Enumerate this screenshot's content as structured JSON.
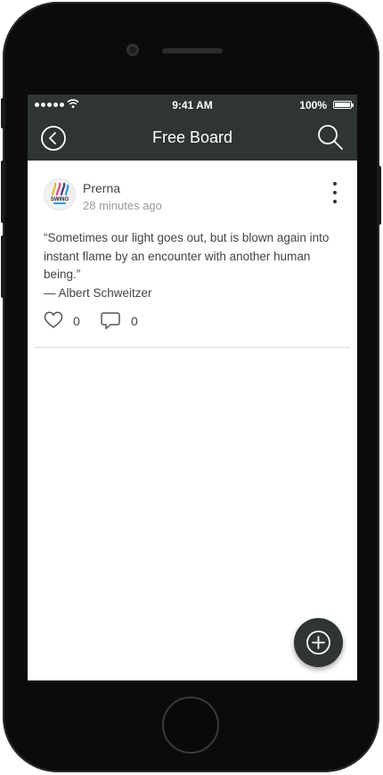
{
  "status_bar": {
    "time": "9:41 AM",
    "battery": "100%",
    "signal_bars": 5,
    "battery_level": 1.0
  },
  "header": {
    "title": "Free Board",
    "back_icon": "chevron-left-circle-icon",
    "search_icon": "search-icon"
  },
  "post": {
    "author": "Prerna",
    "time_ago": "28 minutes ago",
    "avatar_text": "SWING",
    "quote": "“Sometimes our light goes out, but is blown again into instant flame by an encounter with another human being.”",
    "attribution": "— Albert Schweitzer",
    "likes": "0",
    "comments": "0",
    "menu_icon": "more-vertical-icon",
    "like_icon": "heart-outline-icon",
    "comment_icon": "speech-bubble-icon"
  },
  "fab": {
    "icon": "plus-circle-icon"
  },
  "colors": {
    "header_bg": "#2f3530",
    "fab_bg": "#2f3530",
    "text": "#444444",
    "muted": "#9a9a9a"
  }
}
